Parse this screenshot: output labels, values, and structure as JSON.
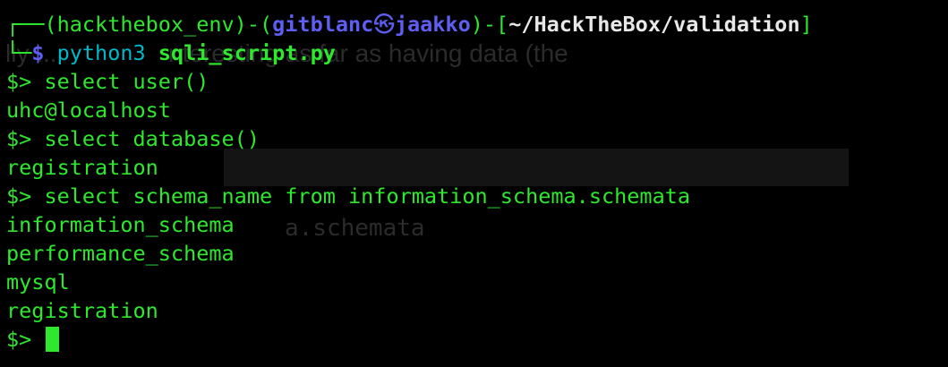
{
  "background_ghost": {
    "line1": "lly ...                nteresting as far as having data (the",
    "line2": "a.schemata"
  },
  "prompt": {
    "corner_top": "┌──",
    "env": "(hackthebox_env)",
    "dash": "-",
    "user": "gitblanc",
    "at_symbol": "㉿",
    "host": "jaakko",
    "dash2": "-",
    "path_open": "[",
    "path": "~/HackTheBox/validation",
    "path_close": "]",
    "corner_bottom": "└─",
    "dollar": "$",
    "command_word": "python3",
    "command_arg": "sqli_script.py"
  },
  "session": [
    {
      "type": "input",
      "prompt": "$>",
      "text": "select user()"
    },
    {
      "type": "output",
      "text": "uhc@localhost"
    },
    {
      "type": "input",
      "prompt": "$>",
      "text": "select database()"
    },
    {
      "type": "output",
      "text": "registration"
    },
    {
      "type": "input",
      "prompt": "$>",
      "text": "select schema_name from information_schema.schemata"
    },
    {
      "type": "output",
      "text": "information_schema"
    },
    {
      "type": "output",
      "text": "performance_schema"
    },
    {
      "type": "output",
      "text": "mysql"
    },
    {
      "type": "output",
      "text": "registration"
    }
  ],
  "final_prompt": "$>",
  "colors": {
    "green": "#2ee82e",
    "blue": "#5e5ef2",
    "cyan": "#00b8c8",
    "white": "#e8e8e8",
    "background": "#000000"
  }
}
